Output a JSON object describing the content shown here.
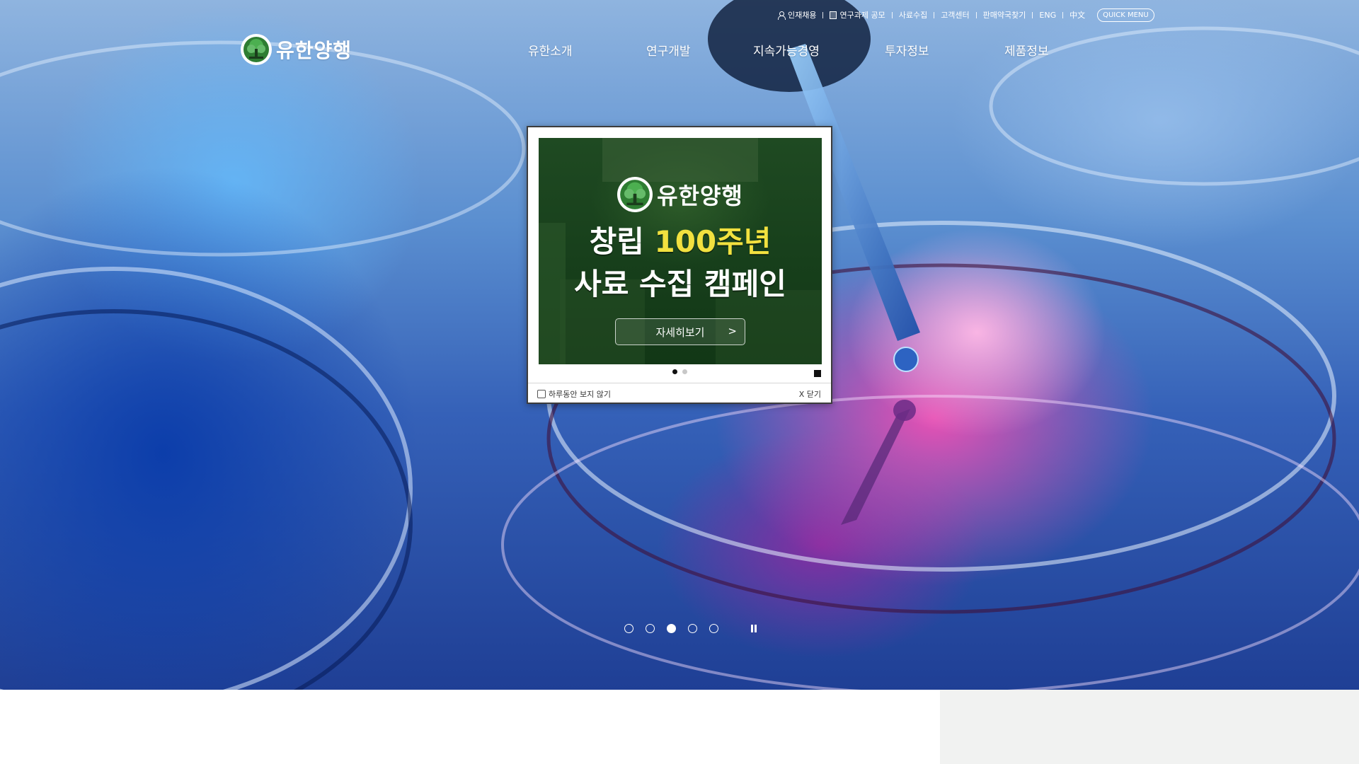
{
  "utility": {
    "items": [
      {
        "label": "인재채용",
        "icon": "person-icon"
      },
      {
        "label": "연구과제 공모",
        "icon": "document-icon"
      },
      {
        "label": "사료수집"
      },
      {
        "label": "고객센터"
      },
      {
        "label": "판매약국찾기"
      },
      {
        "label": "ENG"
      },
      {
        "label": "中文"
      }
    ],
    "quick_menu": "QUICK MENU"
  },
  "logo": {
    "text": "유한양행"
  },
  "nav": {
    "items": [
      {
        "label": "유한소개"
      },
      {
        "label": "연구개발"
      },
      {
        "label": "지속가능경영"
      },
      {
        "label": "투자정보"
      },
      {
        "label": "제품정보"
      }
    ]
  },
  "popup": {
    "banner": {
      "logo_text": "유한양행",
      "title_line1_prefix": "창립 ",
      "title_line1_highlight": "100주년",
      "title_line2": "사료 수집 캠페인",
      "button_label": "자세히보기",
      "button_arrow": ">",
      "ghost_letters": "유한양행"
    },
    "slides": 2,
    "active_slide": 0,
    "no_show_today": "하루동안 보지 않기",
    "close_label": "X 닫기"
  },
  "hero": {
    "slides": 5,
    "active_slide": 2
  },
  "colors": {
    "brand_green": "#1f4a22",
    "highlight_yellow": "#f2e13f",
    "hero_blue": "#3561b8",
    "hero_pink": "#f050b4"
  }
}
